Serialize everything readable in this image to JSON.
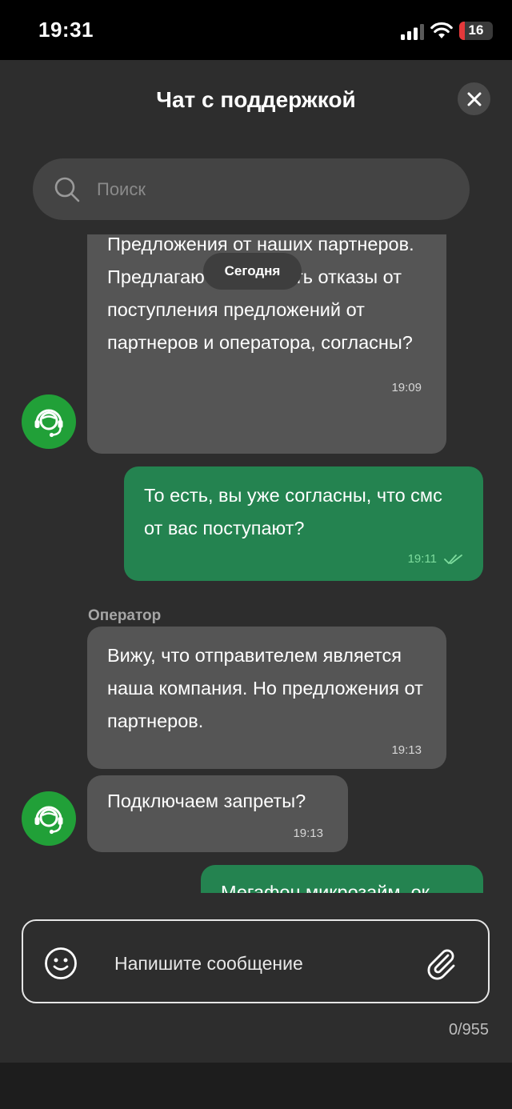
{
  "status_bar": {
    "time": "19:31",
    "battery_level": "16",
    "battery_fraction": 0.16,
    "icons": [
      "signal-icon",
      "wifi-icon",
      "battery-icon"
    ]
  },
  "header": {
    "title": "Чат с поддержкой",
    "close_icon": "close-icon"
  },
  "search": {
    "placeholder": "Поиск",
    "icon": "search-icon"
  },
  "chat": {
    "date_label": "Сегодня",
    "operator_name": "Оператор",
    "messages": [
      {
        "direction": "incoming",
        "text": "Предложения от наших партнеров. Предлагаю подключить отказы от поступления предложений от партнеров и оператора, согласны?",
        "time": "19:09"
      },
      {
        "direction": "outgoing",
        "text": "То есть, вы уже согласны, что смс от вас поступают?",
        "time": "19:11",
        "status_icon": "double-check-icon"
      },
      {
        "direction": "incoming",
        "text": "Вижу, что отправителем является наша компания. Но предложения от партнеров.",
        "time": "19:13"
      },
      {
        "direction": "incoming",
        "text": "Подключаем запреты?",
        "time": "19:13"
      },
      {
        "direction": "outgoing",
        "text": "Мегафон микрозайм, ок",
        "time": ""
      }
    ],
    "scroll_button_icon": "chevron-down-icon"
  },
  "composer": {
    "placeholder": "Напишите сообщение",
    "counter": "0/955",
    "emoji_icon": "emoji-icon",
    "attach_icon": "paperclip-icon"
  },
  "colors": {
    "background": "#2d2d2d",
    "incoming_bubble": "#555555",
    "outgoing_bubble": "#248350",
    "accent_green": "#21a038"
  }
}
